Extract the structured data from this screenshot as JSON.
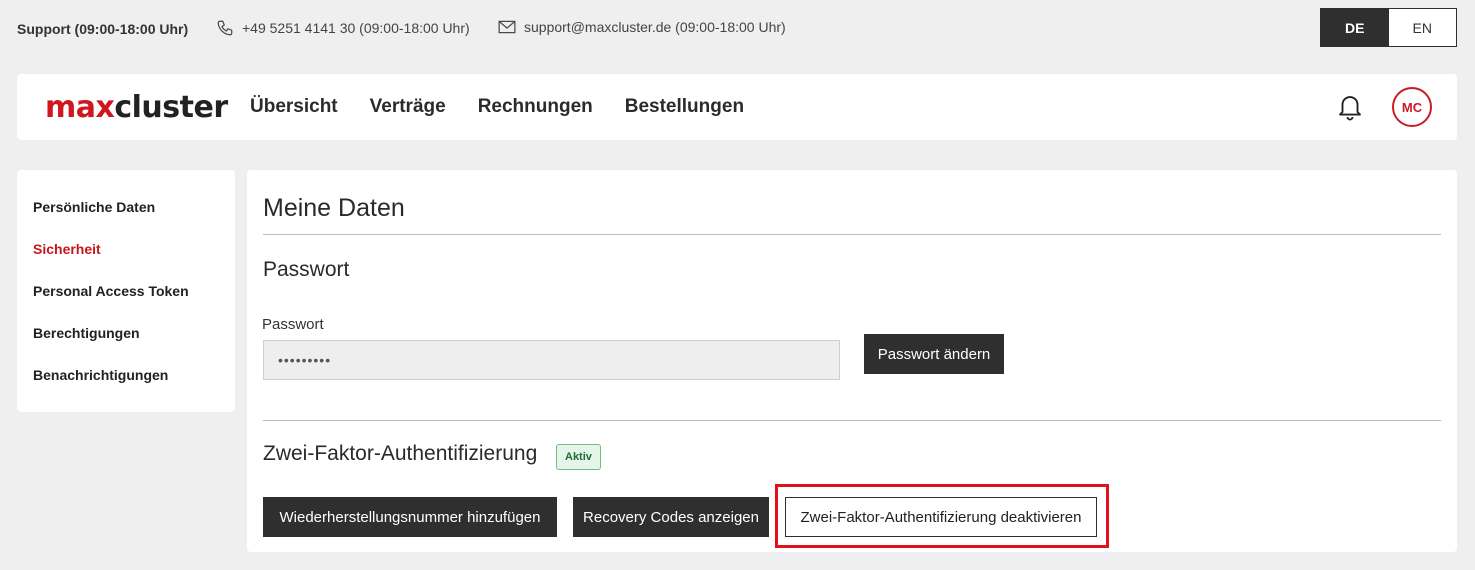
{
  "topbar": {
    "support_label": "Support (09:00-18:00 Uhr)",
    "phone": "+49 5251 4141 30 (09:00-18:00 Uhr)",
    "email": "support@maxcluster.de (09:00-18:00 Uhr)",
    "phone_icon": "phone-icon",
    "mail_icon": "mail-icon",
    "languages": [
      {
        "label": "DE",
        "active": true
      },
      {
        "label": "EN",
        "active": false
      }
    ]
  },
  "header": {
    "logo_part1": "max",
    "logo_part2": "cluster",
    "nav": [
      "Übersicht",
      "Verträge",
      "Rechnungen",
      "Bestellungen"
    ],
    "bell_icon": "bell-icon",
    "avatar_initials": "MC"
  },
  "sidebar": {
    "items": [
      {
        "label": "Persönliche Daten",
        "active": false
      },
      {
        "label": "Sicherheit",
        "active": true
      },
      {
        "label": "Personal Access Token",
        "active": false
      },
      {
        "label": "Berechtigungen",
        "active": false
      },
      {
        "label": "Benachrichtigungen",
        "active": false
      }
    ]
  },
  "main": {
    "title": "Meine Daten",
    "password_section": {
      "title": "Passwort",
      "field_label": "Passwort",
      "field_value": "•••••••••",
      "change_button": "Passwort ändern"
    },
    "twofa_section": {
      "title": "Zwei-Faktor-Authentifizierung",
      "status_badge": "Aktiv",
      "add_recovery_number_button": "Wiederherstellungsnummer hinzufügen",
      "show_recovery_codes_button": "Recovery Codes anzeigen",
      "deactivate_button": "Zwei-Faktor-Authentifizierung deaktivieren"
    }
  },
  "colors": {
    "brand_red": "#d0161e",
    "dark_button": "#2f2f2f",
    "highlight": "#e0111a",
    "badge_bg": "#e5f5e9",
    "badge_text": "#1e6b31"
  }
}
